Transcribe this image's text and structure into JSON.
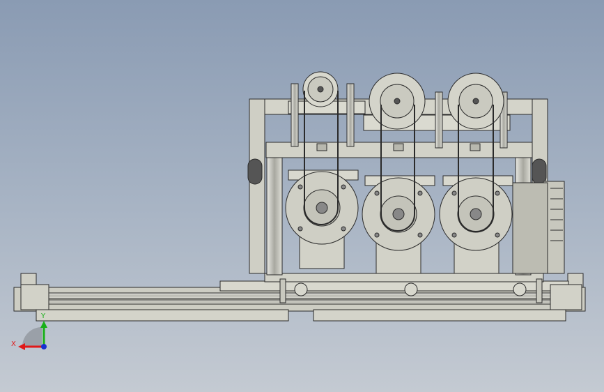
{
  "triad": {
    "x_label": "X",
    "y_label": "Y",
    "x_color": "#e01818",
    "y_color": "#18b018",
    "z_color": "#1830d0"
  },
  "colors": {
    "body": "#cfcfc5",
    "line": "#2a2a2a",
    "background_top": "#8a9bb3",
    "background_bottom": "#c4cad2"
  }
}
